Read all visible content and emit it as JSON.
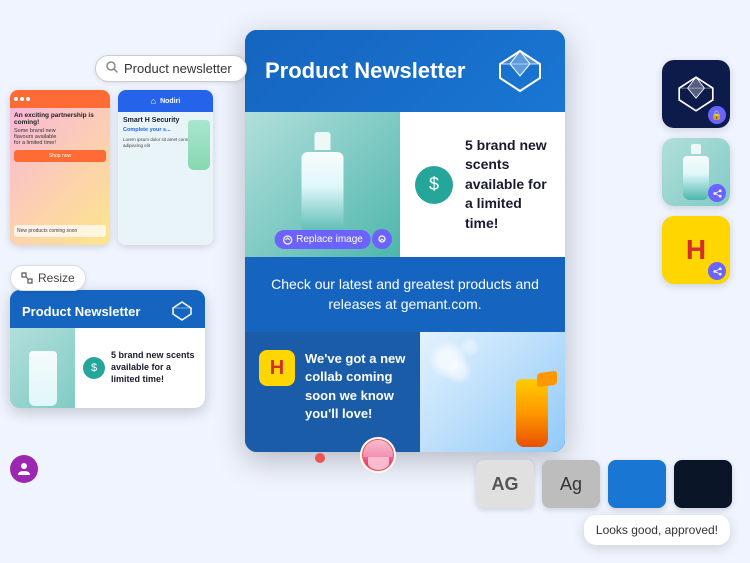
{
  "search": {
    "placeholder": "Product newsletter",
    "value": "Product newsletter"
  },
  "main_newsletter": {
    "title": "Product Newsletter",
    "section1_text": "5 brand new scents available for a limited time!",
    "section2_text": "Check our latest and greatest products and releases at gemant.com.",
    "section3_text": "We've got a new collab coming soon we know you'll love!",
    "replace_btn": "Replace image"
  },
  "left_bottom_card": {
    "title": "Product Newsletter",
    "body_text": "5 brand new scents available for a limited time!"
  },
  "resize_btn": "Resize",
  "comment": {
    "text": "Looks good, approved!"
  },
  "right_icons": {
    "item1_label": "gem-lock",
    "item2_label": "bottle-share",
    "item3_label": "h-share"
  },
  "bottom_icons": {
    "ag_gray": "AG",
    "ag_light": "Ag",
    "blue_square": "",
    "navy_square": ""
  }
}
